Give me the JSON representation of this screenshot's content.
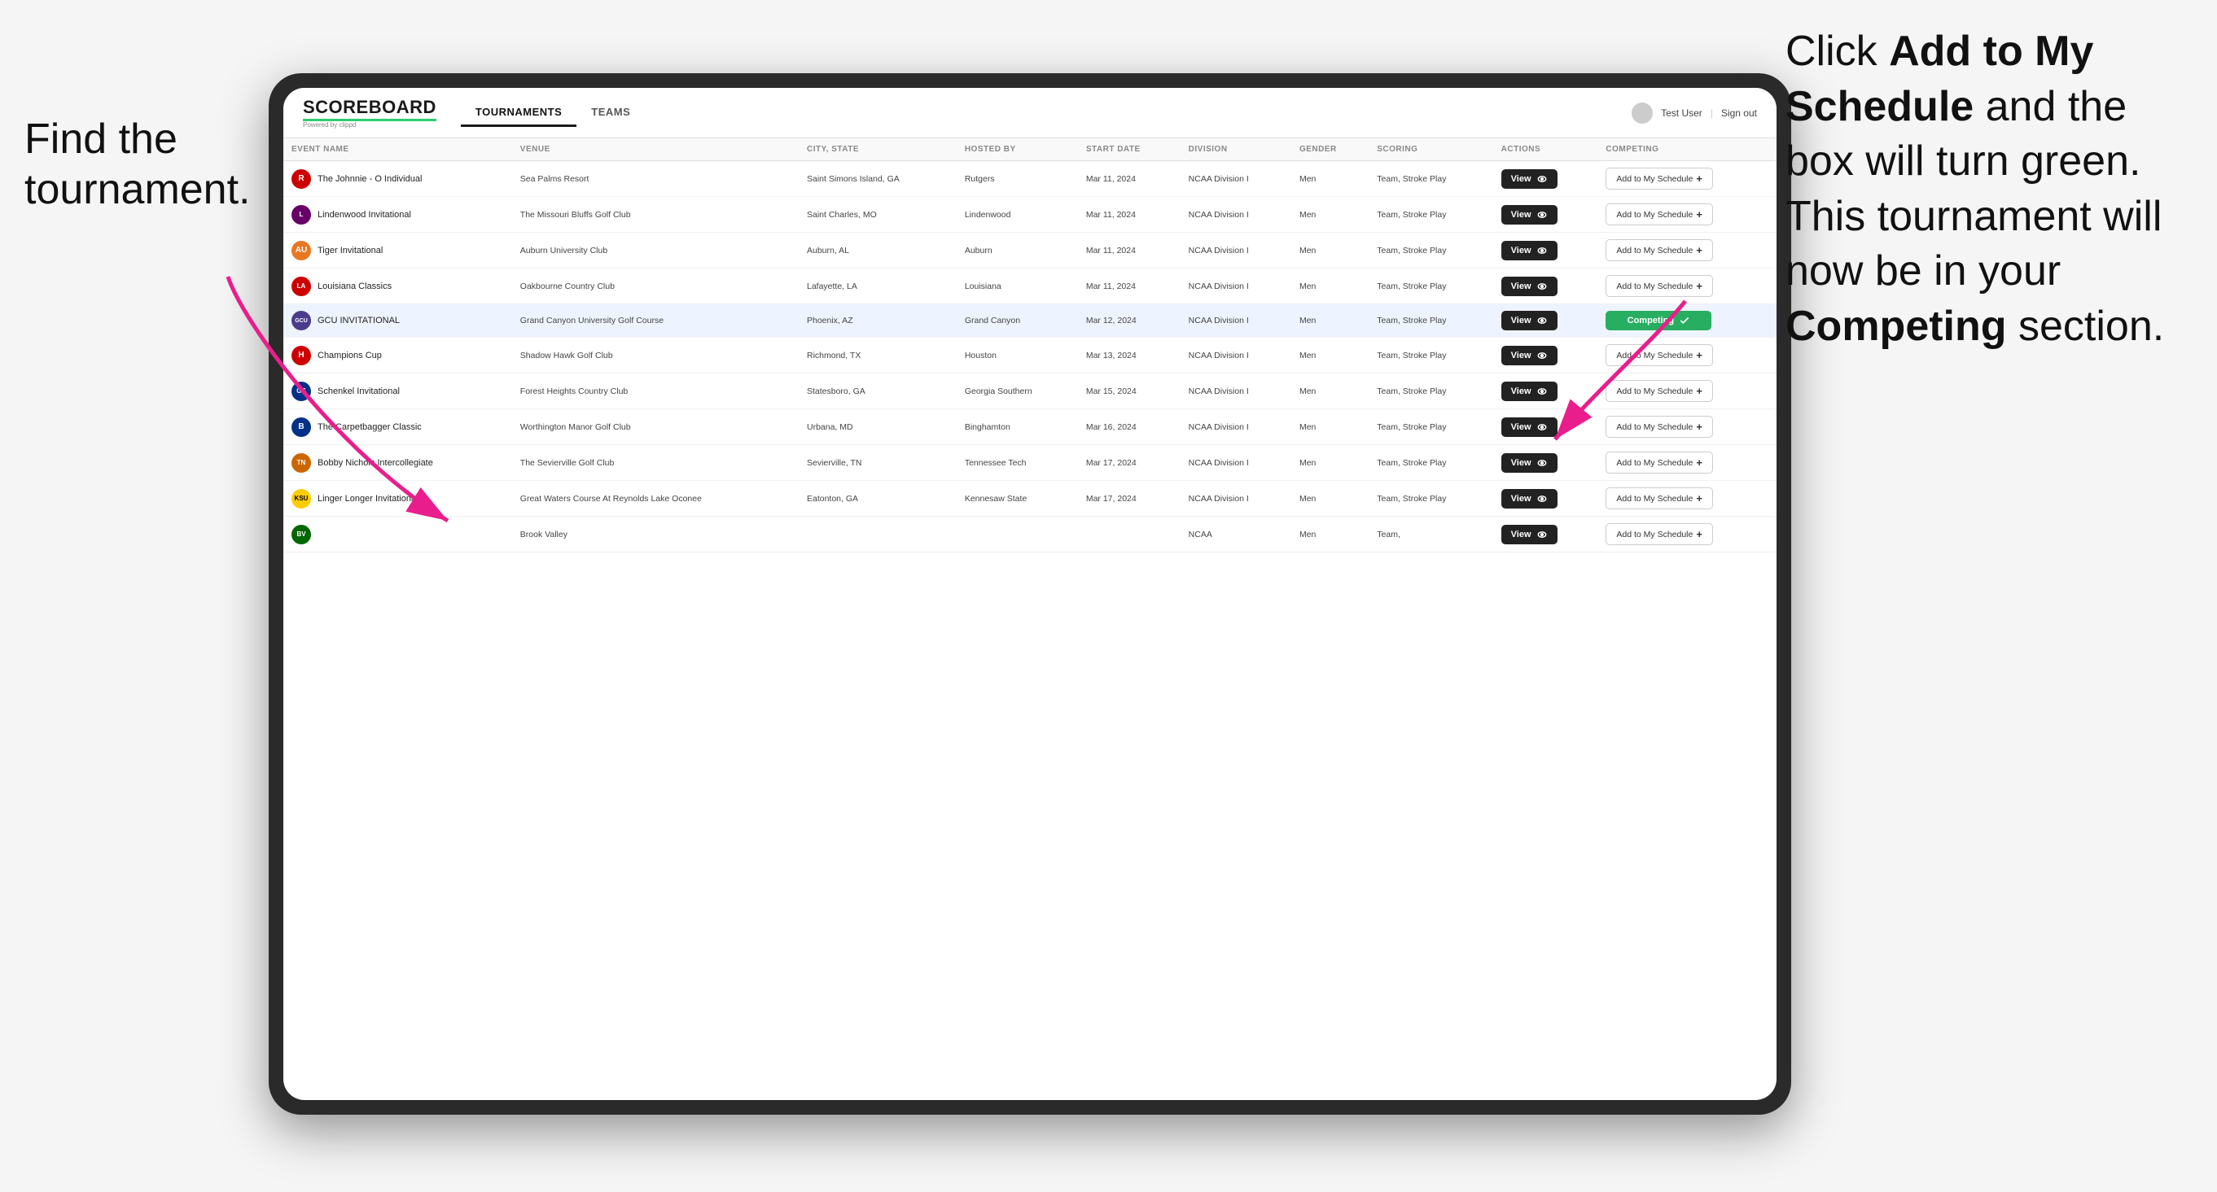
{
  "page": {
    "background": "#f5f5f5"
  },
  "annotation_left": {
    "line1": "Find the",
    "line2": "tournament."
  },
  "annotation_right": {
    "text_plain1": "Click ",
    "text_bold1": "Add to My",
    "text_plain2": "",
    "text_bold2": "Schedule",
    "text_plain3": " and the box will turn green. This tournament will now be in your ",
    "text_bold3": "Competing",
    "text_plain4": " section."
  },
  "header": {
    "logo": "SCOREBOARD",
    "logo_sub": "Powered by clippd",
    "nav": [
      {
        "label": "TOURNAMENTS",
        "active": true
      },
      {
        "label": "TEAMS",
        "active": false
      }
    ],
    "user": "Test User",
    "sign_out": "Sign out"
  },
  "table": {
    "columns": [
      {
        "key": "event_name",
        "label": "EVENT NAME"
      },
      {
        "key": "venue",
        "label": "VENUE"
      },
      {
        "key": "city_state",
        "label": "CITY, STATE"
      },
      {
        "key": "hosted_by",
        "label": "HOSTED BY"
      },
      {
        "key": "start_date",
        "label": "START DATE"
      },
      {
        "key": "division",
        "label": "DIVISION"
      },
      {
        "key": "gender",
        "label": "GENDER"
      },
      {
        "key": "scoring",
        "label": "SCORING"
      },
      {
        "key": "actions",
        "label": "ACTIONS"
      },
      {
        "key": "competing",
        "label": "COMPETING"
      }
    ],
    "rows": [
      {
        "id": 1,
        "logo_text": "R",
        "logo_class": "logo-r",
        "event_name": "The Johnnie - O Individual",
        "venue": "Sea Palms Resort",
        "city_state": "Saint Simons Island, GA",
        "hosted_by": "Rutgers",
        "start_date": "Mar 11, 2024",
        "division": "NCAA Division I",
        "gender": "Men",
        "scoring": "Team, Stroke Play",
        "competing_state": "add",
        "highlighted": false
      },
      {
        "id": 2,
        "logo_text": "L",
        "logo_class": "logo-l",
        "event_name": "Lindenwood Invitational",
        "venue": "The Missouri Bluffs Golf Club",
        "city_state": "Saint Charles, MO",
        "hosted_by": "Lindenwood",
        "start_date": "Mar 11, 2024",
        "division": "NCAA Division I",
        "gender": "Men",
        "scoring": "Team, Stroke Play",
        "competing_state": "add",
        "highlighted": false
      },
      {
        "id": 3,
        "logo_text": "AU",
        "logo_class": "logo-auburn",
        "event_name": "Tiger Invitational",
        "venue": "Auburn University Club",
        "city_state": "Auburn, AL",
        "hosted_by": "Auburn",
        "start_date": "Mar 11, 2024",
        "division": "NCAA Division I",
        "gender": "Men",
        "scoring": "Team, Stroke Play",
        "competing_state": "add",
        "highlighted": false
      },
      {
        "id": 4,
        "logo_text": "LA",
        "logo_class": "logo-la",
        "event_name": "Louisiana Classics",
        "venue": "Oakbourne Country Club",
        "city_state": "Lafayette, LA",
        "hosted_by": "Louisiana",
        "start_date": "Mar 11, 2024",
        "division": "NCAA Division I",
        "gender": "Men",
        "scoring": "Team, Stroke Play",
        "competing_state": "add",
        "highlighted": false
      },
      {
        "id": 5,
        "logo_text": "GCU",
        "logo_class": "logo-gcu",
        "event_name": "GCU INVITATIONAL",
        "venue": "Grand Canyon University Golf Course",
        "city_state": "Phoenix, AZ",
        "hosted_by": "Grand Canyon",
        "start_date": "Mar 12, 2024",
        "division": "NCAA Division I",
        "gender": "Men",
        "scoring": "Team, Stroke Play",
        "competing_state": "competing",
        "highlighted": true
      },
      {
        "id": 6,
        "logo_text": "H",
        "logo_class": "logo-uh",
        "event_name": "Champions Cup",
        "venue": "Shadow Hawk Golf Club",
        "city_state": "Richmond, TX",
        "hosted_by": "Houston",
        "start_date": "Mar 13, 2024",
        "division": "NCAA Division I",
        "gender": "Men",
        "scoring": "Team, Stroke Play",
        "competing_state": "add",
        "highlighted": false
      },
      {
        "id": 7,
        "logo_text": "GS",
        "logo_class": "logo-gs",
        "event_name": "Schenkel Invitational",
        "venue": "Forest Heights Country Club",
        "city_state": "Statesboro, GA",
        "hosted_by": "Georgia Southern",
        "start_date": "Mar 15, 2024",
        "division": "NCAA Division I",
        "gender": "Men",
        "scoring": "Team, Stroke Play",
        "competing_state": "add",
        "highlighted": false
      },
      {
        "id": 8,
        "logo_text": "B",
        "logo_class": "logo-b",
        "event_name": "The Carpetbagger Classic",
        "venue": "Worthington Manor Golf Club",
        "city_state": "Urbana, MD",
        "hosted_by": "Binghamton",
        "start_date": "Mar 16, 2024",
        "division": "NCAA Division I",
        "gender": "Men",
        "scoring": "Team, Stroke Play",
        "competing_state": "add",
        "highlighted": false
      },
      {
        "id": 9,
        "logo_text": "TN",
        "logo_class": "logo-tn",
        "event_name": "Bobby Nichols Intercollegiate",
        "venue": "The Sevierville Golf Club",
        "city_state": "Sevierville, TN",
        "hosted_by": "Tennessee Tech",
        "start_date": "Mar 17, 2024",
        "division": "NCAA Division I",
        "gender": "Men",
        "scoring": "Team, Stroke Play",
        "competing_state": "add",
        "highlighted": false
      },
      {
        "id": 10,
        "logo_text": "KSU",
        "logo_class": "logo-ksu",
        "event_name": "Linger Longer Invitational",
        "venue": "Great Waters Course At Reynolds Lake Oconee",
        "city_state": "Eatonton, GA",
        "hosted_by": "Kennesaw State",
        "start_date": "Mar 17, 2024",
        "division": "NCAA Division I",
        "gender": "Men",
        "scoring": "Team, Stroke Play",
        "competing_state": "add",
        "highlighted": false
      },
      {
        "id": 11,
        "logo_text": "BV",
        "logo_class": "logo-bv",
        "event_name": "",
        "venue": "Brook Valley",
        "city_state": "",
        "hosted_by": "",
        "start_date": "",
        "division": "NCAA",
        "gender": "Men",
        "scoring": "Team,",
        "competing_state": "add",
        "highlighted": false
      }
    ],
    "buttons": {
      "view_label": "View",
      "add_label": "Add to My Schedule",
      "competing_label": "Competing"
    }
  }
}
